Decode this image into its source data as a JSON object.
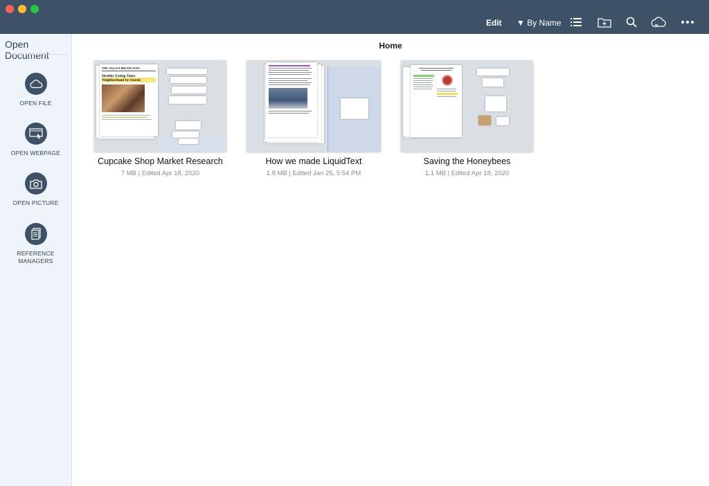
{
  "toolbar": {
    "edit_label": "Edit",
    "sort_label": "▼ By Name",
    "icons": [
      "list-view-icon",
      "new-folder-icon",
      "search-icon",
      "cloud-sync-icon",
      "more-icon"
    ]
  },
  "sidebar": {
    "title": "Open Document",
    "items": [
      {
        "label": "OPEN FILE",
        "icon": "cloud-icon"
      },
      {
        "label": "OPEN WEBPAGE",
        "icon": "webpage-icon"
      },
      {
        "label": "OPEN PICTURE",
        "icon": "camera-icon"
      },
      {
        "label": "REFERENCE MANAGERS",
        "icon": "document-icon"
      }
    ]
  },
  "main": {
    "title": "Home",
    "documents": [
      {
        "name": "Cupcake Shop Market Research",
        "meta": "7 MB | Edited Apr 18, 2020",
        "thumb_heading": "THE VALLEY BROOK POST",
        "thumb_headline": "Healthy Eating Takes Neighborhood by Storm!"
      },
      {
        "name": "How we made LiquidText",
        "meta": "1.8 MB | Edited Jan 25, 5:54 PM"
      },
      {
        "name": "Saving the Honeybees",
        "meta": "1.1 MB | Edited Apr 18, 2020"
      }
    ]
  },
  "colors": {
    "toolbar_bg": "#3e5267",
    "sidebar_bg": "#eef4fa",
    "sidebar_icon_bg": "#3e5267"
  }
}
